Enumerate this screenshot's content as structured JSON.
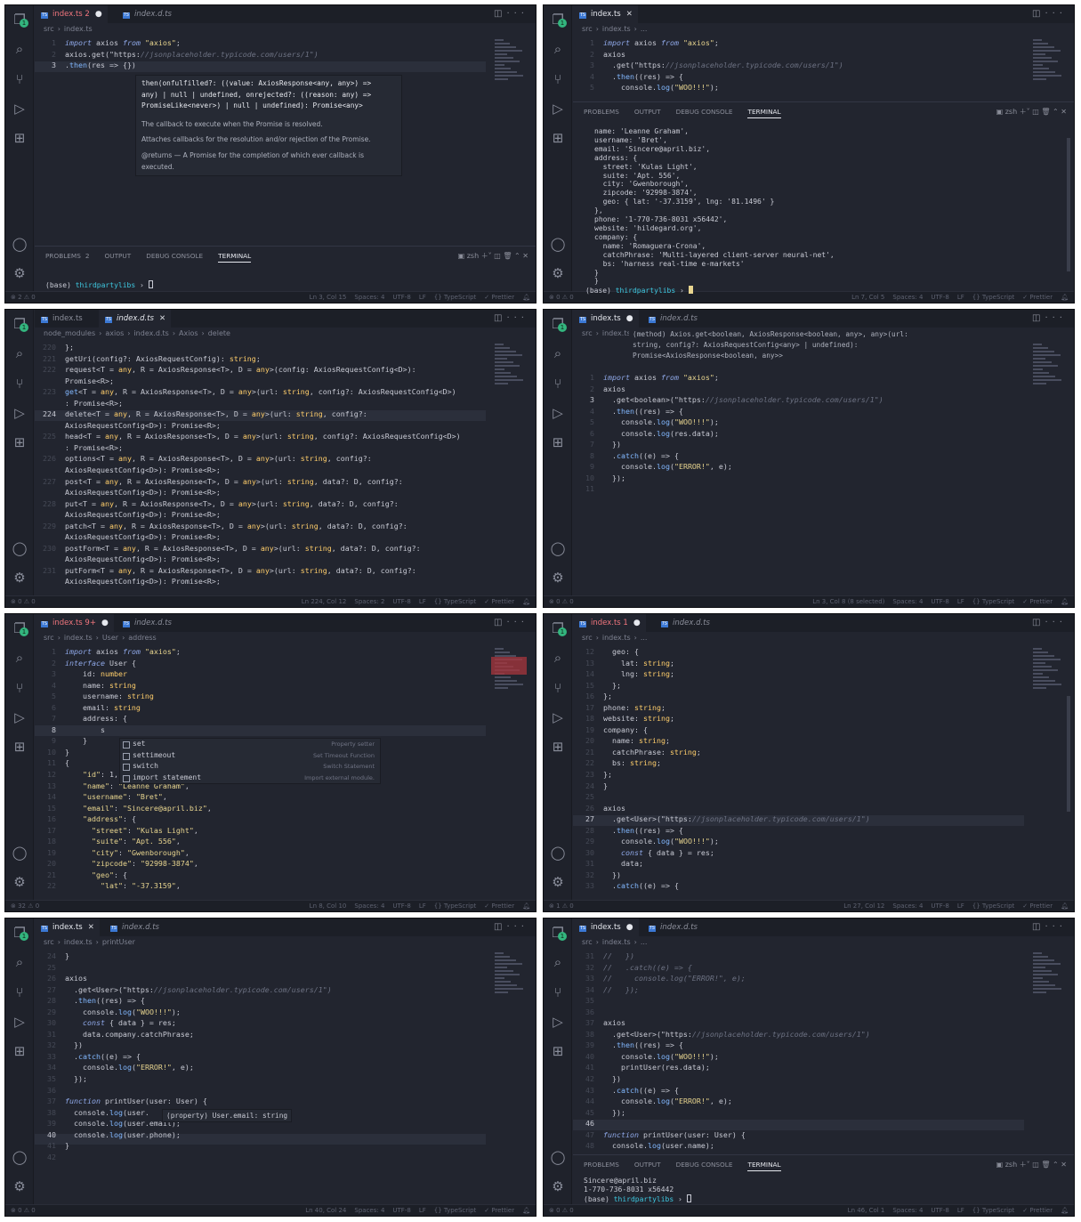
{
  "p1": {
    "tab1": "index.ts",
    "tab1_count": "2",
    "tab2": "index.d.ts",
    "crumb": [
      "src",
      "index.ts"
    ],
    "code": [
      [
        "1",
        "import axios from \"axios\";"
      ],
      [
        "2",
        "axios.get(\"https://jsonplaceholder.typicode.com/users/1\")"
      ],
      [
        "3",
        ".then(res => {})"
      ]
    ],
    "hover": [
      "then(onfulfilled?: ((value: AxiosResponse<any, any>) =>",
      "any) | null | undefined, onrejected?: ((reason: any) =>",
      "PromiseLike<never>) | null | undefined): Promise<any>"
    ],
    "hover_doc": [
      "The callback to execute when the Promise is resolved.",
      "Attaches callbacks for the resolution and/or rejection of the Promise.",
      "@returns — A Promise for the completion of which ever callback is",
      "executed."
    ],
    "term_tabs": [
      "PROBLEMS",
      "2",
      "OUTPUT",
      "DEBUG CONSOLE",
      "TERMINAL"
    ],
    "shell": "zsh",
    "prompt": "(base) thirdpartylibs ›",
    "status_left": "⊗ 2 ⚠ 0",
    "status_right": [
      "Ln 3, Col 15",
      "Spaces: 4",
      "UTF-8",
      "LF",
      "{} TypeScript",
      "✓ Prettier"
    ]
  },
  "p2": {
    "tab1": "index.ts",
    "crumb": [
      "src",
      "index.ts",
      "..."
    ],
    "code": [
      [
        "1",
        "import axios from \"axios\";"
      ],
      [
        "2",
        "axios"
      ],
      [
        "3",
        "  .get(\"https://jsonplaceholder.typicode.com/users/1\")"
      ],
      [
        "4",
        "  .then((res) => {"
      ],
      [
        "5",
        "    console.log(\"WOO!!!\");"
      ]
    ],
    "term_tabs": [
      "PROBLEMS",
      "OUTPUT",
      "DEBUG CONSOLE",
      "TERMINAL"
    ],
    "shell": "zsh",
    "output": [
      "name: 'Leanne Graham',",
      "username: 'Bret',",
      "email: 'Sincere@april.biz',",
      "address: {",
      "  street: 'Kulas Light',",
      "  suite: 'Apt. 556',",
      "  city: 'Gwenborough',",
      "  zipcode: '92998-3874',",
      "  geo: { lat: '-37.3159', lng: '81.1496' }",
      "},",
      "phone: '1-770-736-8031 x56442',",
      "website: 'hildegard.org',",
      "company: {",
      "  name: 'Romaguera-Crona',",
      "  catchPhrase: 'Multi-layered client-server neural-net',",
      "  bs: 'harness real-time e-markets'",
      "}",
      "}"
    ],
    "prompt": "(base) thirdpartylibs ›",
    "status_left": "⊗ 0 ⚠ 0",
    "status_right": [
      "Ln 7, Col 5",
      "Spaces: 4",
      "UTF-8",
      "LF",
      "{} TypeScript",
      "✓ Prettier"
    ]
  },
  "p3": {
    "tab1": "index.ts",
    "tab2": "index.d.ts",
    "crumb": [
      "node_modules",
      "axios",
      "index.d.ts",
      "Axios",
      "delete"
    ],
    "code": [
      [
        "220",
        "};"
      ],
      [
        "221",
        "getUri(config?: AxiosRequestConfig): string;"
      ],
      [
        "222",
        "request<T = any, R = AxiosResponse<T>, D = any>(config: AxiosRequestConfig<D>):"
      ],
      [
        "",
        "Promise<R>;"
      ],
      [
        "223",
        "get<T = any, R = AxiosResponse<T>, D = any>(url: string, config?: AxiosRequestConfig<D>)"
      ],
      [
        "",
        ": Promise<R>;"
      ],
      [
        "224",
        "delete<T = any, R = AxiosResponse<T>, D = any>(url: string, config?:"
      ],
      [
        "",
        "AxiosRequestConfig<D>): Promise<R>;"
      ],
      [
        "225",
        "head<T = any, R = AxiosResponse<T>, D = any>(url: string, config?: AxiosRequestConfig<D>)"
      ],
      [
        "",
        ": Promise<R>;"
      ],
      [
        "226",
        "options<T = any, R = AxiosResponse<T>, D = any>(url: string, config?:"
      ],
      [
        "",
        "AxiosRequestConfig<D>): Promise<R>;"
      ],
      [
        "227",
        "post<T = any, R = AxiosResponse<T>, D = any>(url: string, data?: D, config?:"
      ],
      [
        "",
        "AxiosRequestConfig<D>): Promise<R>;"
      ],
      [
        "228",
        "put<T = any, R = AxiosResponse<T>, D = any>(url: string, data?: D, config?:"
      ],
      [
        "",
        "AxiosRequestConfig<D>): Promise<R>;"
      ],
      [
        "229",
        "patch<T = any, R = AxiosResponse<T>, D = any>(url: string, data?: D, config?:"
      ],
      [
        "",
        "AxiosRequestConfig<D>): Promise<R>;"
      ],
      [
        "230",
        "postForm<T = any, R = AxiosResponse<T>, D = any>(url: string, data?: D, config?:"
      ],
      [
        "",
        "AxiosRequestConfig<D>): Promise<R>;"
      ],
      [
        "231",
        "putForm<T = any, R = AxiosResponse<T>, D = any>(url: string, data?: D, config?:"
      ],
      [
        "",
        "AxiosRequestConfig<D>): Promise<R>;"
      ]
    ],
    "status_left": "⊗ 0 ⚠ 0",
    "status_right": [
      "Ln 224, Col 12",
      "Spaces: 2",
      "UTF-8",
      "LF",
      "{} TypeScript",
      "✓ Prettier"
    ]
  },
  "p4": {
    "tab1": "index.ts",
    "tab2": "index.d.ts",
    "crumb": [
      "src",
      "index.ts"
    ],
    "hover": [
      "(method) Axios.get<boolean, AxiosResponse<boolean, any>, any>(url:",
      "string, config?: AxiosRequestConfig<any> | undefined):",
      "Promise<AxiosResponse<boolean, any>>"
    ],
    "code": [
      [
        "1",
        "import axios from \"axios\";"
      ],
      [
        "2",
        "axios"
      ],
      [
        "3",
        "  .get<boolean>(\"https://jsonplaceholder.typicode.com/users/1\")"
      ],
      [
        "4",
        "  .then((res) => {"
      ],
      [
        "5",
        "    console.log(\"WOO!!!\");"
      ],
      [
        "6",
        "    console.log(res.data);"
      ],
      [
        "7",
        "  })"
      ],
      [
        "8",
        "  .catch((e) => {"
      ],
      [
        "9",
        "    console.log(\"ERROR!\", e);"
      ],
      [
        "10",
        "  });"
      ],
      [
        "11",
        ""
      ]
    ],
    "status_left": "⊗ 0 ⚠ 0",
    "status_right": [
      "Ln 3, Col 8 (8 selected)",
      "Spaces: 4",
      "UTF-8",
      "LF",
      "{} TypeScript",
      "✓ Prettier"
    ]
  },
  "p5": {
    "tab1": "index.ts",
    "tab1_count": "9+",
    "tab2": "index.d.ts",
    "crumb": [
      "src",
      "index.ts",
      "User",
      "address"
    ],
    "code": [
      [
        "1",
        "import axios from \"axios\";"
      ],
      [
        "2",
        "interface User {"
      ],
      [
        "3",
        "    id: number"
      ],
      [
        "4",
        "    name: string"
      ],
      [
        "5",
        "    username: string"
      ],
      [
        "6",
        "    email: string"
      ],
      [
        "7",
        "    address: {"
      ],
      [
        "8",
        "        s"
      ],
      [
        "9",
        "    }"
      ],
      [
        "10",
        "}"
      ],
      [
        "11",
        "{"
      ],
      [
        "12",
        "    \"id\": 1,"
      ],
      [
        "13",
        "    \"name\": \"Leanne Graham\","
      ],
      [
        "14",
        "    \"username\": \"Bret\","
      ],
      [
        "15",
        "    \"email\": \"Sincere@april.biz\","
      ],
      [
        "16",
        "    \"address\": {"
      ],
      [
        "17",
        "      \"street\": \"Kulas Light\","
      ],
      [
        "18",
        "      \"suite\": \"Apt. 556\","
      ],
      [
        "19",
        "      \"city\": \"Gwenborough\","
      ],
      [
        "20",
        "      \"zipcode\": \"92998-3874\","
      ],
      [
        "21",
        "      \"geo\": {"
      ],
      [
        "22",
        "        \"lat\": \"-37.3159\","
      ]
    ],
    "suggest": [
      [
        "set",
        "Property setter"
      ],
      [
        "settimeout",
        "Set Timeout Function"
      ],
      [
        "switch",
        "Switch Statement"
      ],
      [
        "import statement",
        "Import external module."
      ]
    ],
    "status_left": "⊗ 32 ⚠ 0",
    "status_right": [
      "Ln 8, Col 10",
      "Spaces: 4",
      "UTF-8",
      "LF",
      "{} TypeScript",
      "✓ Prettier"
    ]
  },
  "p6": {
    "tab1": "index.ts",
    "tab1_count": "1",
    "tab2": "index.d.ts",
    "crumb": [
      "src",
      "index.ts",
      "..."
    ],
    "code": [
      [
        "12",
        "  geo: {"
      ],
      [
        "13",
        "    lat: string;"
      ],
      [
        "14",
        "    lng: string;"
      ],
      [
        "15",
        "  };"
      ],
      [
        "16",
        "};"
      ],
      [
        "17",
        "phone: string;"
      ],
      [
        "18",
        "website: string;"
      ],
      [
        "19",
        "company: {"
      ],
      [
        "20",
        "  name: string;"
      ],
      [
        "21",
        "  catchPhrase: string;"
      ],
      [
        "22",
        "  bs: string;"
      ],
      [
        "23",
        "};"
      ],
      [
        "24",
        "}"
      ],
      [
        "25",
        ""
      ],
      [
        "26",
        "axios"
      ],
      [
        "27",
        "  .get<User>(\"https://jsonplaceholder.typicode.com/users/1\")"
      ],
      [
        "28",
        "  .then((res) => {"
      ],
      [
        "29",
        "    console.log(\"WOO!!!\");"
      ],
      [
        "30",
        "    const { data } = res;"
      ],
      [
        "31",
        "    data;"
      ],
      [
        "32",
        "  })"
      ],
      [
        "33",
        "  .catch((e) => {"
      ]
    ],
    "status_left": "⊗ 1 ⚠ 0",
    "status_right": [
      "Ln 27, Col 12",
      "Spaces: 4",
      "UTF-8",
      "LF",
      "{} TypeScript",
      "✓ Prettier"
    ]
  },
  "p7": {
    "tab1": "index.ts",
    "tab2": "index.d.ts",
    "crumb": [
      "src",
      "index.ts",
      "printUser"
    ],
    "code": [
      [
        "24",
        "}"
      ],
      [
        "25",
        ""
      ],
      [
        "26",
        "axios"
      ],
      [
        "27",
        "  .get<User>(\"https://jsonplaceholder.typicode.com/users/1\")"
      ],
      [
        "28",
        "  .then((res) => {"
      ],
      [
        "29",
        "    console.log(\"WOO!!!\");"
      ],
      [
        "30",
        "    const { data } = res;"
      ],
      [
        "31",
        "    data.company.catchPhrase;"
      ],
      [
        "32",
        "  })"
      ],
      [
        "33",
        "  .catch((e) => {"
      ],
      [
        "34",
        "    console.log(\"ERROR!\", e);"
      ],
      [
        "35",
        "  });"
      ],
      [
        "36",
        ""
      ],
      [
        "37",
        "function printUser(user: User) {"
      ],
      [
        "38",
        "  console.log(user."
      ],
      [
        "39",
        "  console.log(user.email);"
      ],
      [
        "40",
        "  console.log(user.phone);"
      ],
      [
        "41",
        "}"
      ],
      [
        "42",
        ""
      ]
    ],
    "hover": "(property) User.email: string",
    "status_left": "⊗ 0 ⚠ 0",
    "status_right": [
      "Ln 40, Col 24",
      "Spaces: 4",
      "UTF-8",
      "LF",
      "{} TypeScript",
      "✓ Prettier"
    ]
  },
  "p8": {
    "tab1": "index.ts",
    "tab2": "index.d.ts",
    "crumb": [
      "src",
      "index.ts",
      "..."
    ],
    "code": [
      [
        "31",
        "//   })"
      ],
      [
        "32",
        "//   .catch((e) => {"
      ],
      [
        "33",
        "//     console.log(\"ERROR!\", e);"
      ],
      [
        "34",
        "//   });"
      ],
      [
        "35",
        ""
      ],
      [
        "36",
        ""
      ],
      [
        "37",
        "axios"
      ],
      [
        "38",
        "  .get<User>(\"https://jsonplaceholder.typicode.com/users/1\")"
      ],
      [
        "39",
        "  .then((res) => {"
      ],
      [
        "40",
        "    console.log(\"WOO!!!\");"
      ],
      [
        "41",
        "    printUser(res.data);"
      ],
      [
        "42",
        "  })"
      ],
      [
        "43",
        "  .catch((e) => {"
      ],
      [
        "44",
        "    console.log(\"ERROR!\", e);"
      ],
      [
        "45",
        "  });"
      ],
      [
        "46",
        ""
      ],
      [
        "47",
        "function printUser(user: User) {"
      ],
      [
        "48",
        "  console.log(user.name);"
      ]
    ],
    "term_tabs": [
      "PROBLEMS",
      "OUTPUT",
      "DEBUG CONSOLE",
      "TERMINAL"
    ],
    "shell": "zsh",
    "output": [
      "Sincere@april.biz",
      "1-770-736-8031 x56442"
    ],
    "prompt": "(base) thirdpartylibs ›",
    "status_left": "⊗ 0 ⚠ 0",
    "status_right": [
      "Ln 46, Col 1",
      "Spaces: 4",
      "UTF-8",
      "LF",
      "{} TypeScript",
      "✓ Prettier"
    ]
  },
  "icons": [
    "files-icon",
    "search-icon",
    "source-control-icon",
    "run-debug-icon",
    "extensions-icon",
    "account-icon",
    "settings-gear-icon"
  ],
  "colors": {
    "editor_bg": "#22252f",
    "keyword": "#8fa8e8",
    "string": "#e8d58f",
    "url": "#b9e08c",
    "error_tab": "#f0757d",
    "badge": "#33b57e"
  }
}
